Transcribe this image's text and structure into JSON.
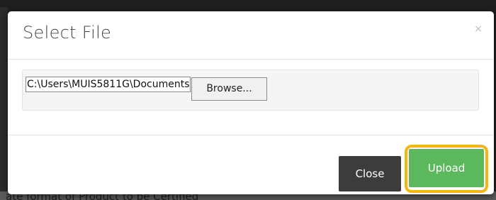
{
  "dialog": {
    "title": "Select File",
    "close_glyph": "×",
    "file_input": {
      "value": "C:\\Users\\MUIS5811G\\Documents",
      "browse_label": "Browse..."
    },
    "footer": {
      "close_label": "Close",
      "upload_label": "Upload"
    }
  },
  "background": {
    "partial_text": "ate format of Product to be Certified"
  },
  "colors": {
    "upload_button": "#5cb85c",
    "close_button": "#3c3c3c",
    "highlight": "#f7b514"
  },
  "icons": {
    "close": "close-icon"
  }
}
